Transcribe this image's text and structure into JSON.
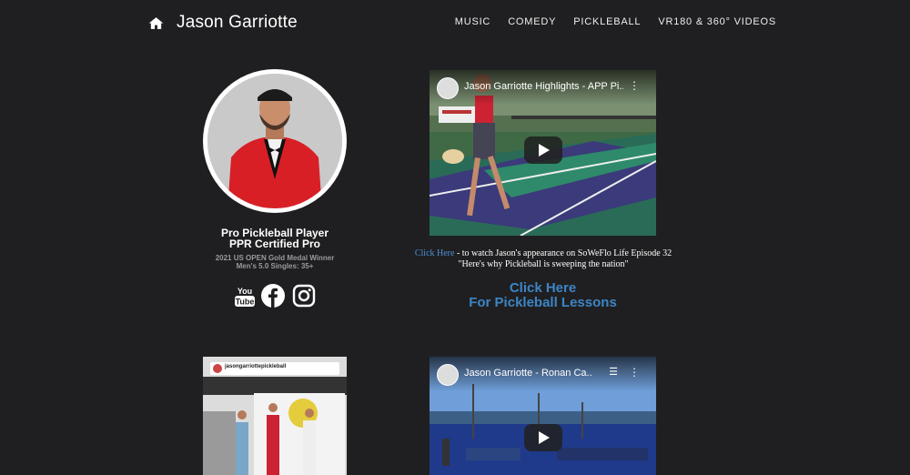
{
  "header": {
    "brand": "Jason Garriotte",
    "nav": [
      "MUSIC",
      "COMEDY",
      "PICKLEBALL",
      "VR180 & 360° VIDEOS"
    ]
  },
  "profile": {
    "title_line1": "Pro Pickleball Player",
    "title_line2": "PPR Certified Pro",
    "sub_line1": "2021 US OPEN Gold Medal Winner",
    "sub_line2": "Men's 5.0 Singles: 35+"
  },
  "social": [
    "youtube-icon",
    "facebook-icon",
    "instagram-icon"
  ],
  "videos": [
    {
      "title": "Jason Garriotte Highlights - APP Pi..."
    },
    {
      "title": "Jason Garriotte - Ronan Ca..."
    }
  ],
  "caption": {
    "link": "Click Here",
    "line1_rest": " - to watch Jason's appearance on SoWeFlo Life Episode 32",
    "line2": "\"Here's why Pickleball is sweeping the nation\""
  },
  "lessons": {
    "line1": "Click Here",
    "line2": "For Pickleball Lessons"
  },
  "instagram": {
    "username": "jasongarriottepickleball"
  }
}
